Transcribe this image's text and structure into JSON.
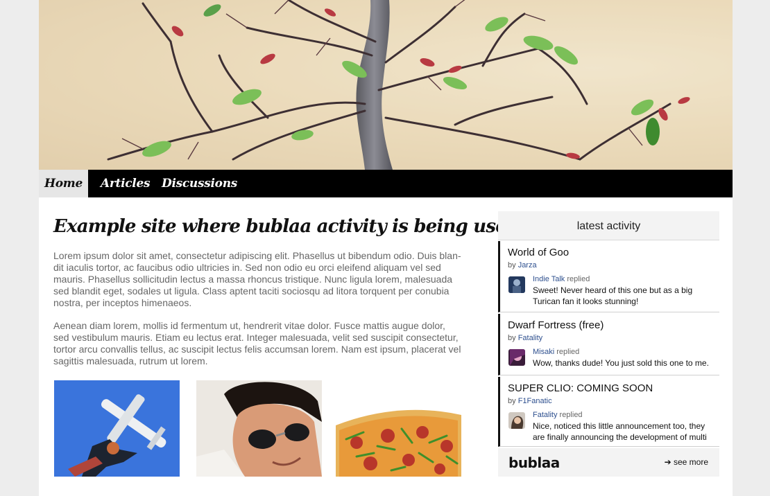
{
  "nav": {
    "items": [
      {
        "label": "Home",
        "active": true
      },
      {
        "label": "Articles",
        "active": false
      },
      {
        "label": "Discussions",
        "active": false
      }
    ]
  },
  "main": {
    "headline": "Example site where bublaa activity is being used",
    "paragraphs": [
      "Lorem ipsum dolor sit amet, consectetur adipiscing elit. Phasellus ut bibendum odio. Duis blan-dit iaculis tortor, ac faucibus odio ultricies in. Sed non odio eu orci eleifend aliquam vel sed mauris. Phasellus sollicitudin lectus a massa rhoncus tristique. Nunc ligula lorem, malesuada sed blandit eget, sodales ut ligula. Class aptent taciti sociosqu ad litora torquent per conubia nostra, per inceptos himenaeos.",
      "Aenean diam lorem, mollis id fermentum ut, hendrerit vitae dolor. Fusce mattis augue dolor, sed vestibulum mauris. Etiam eu lectus erat. Integer malesuada, velit sed suscipit consectetur, tortor arcu convallis tellus, ac suscipit lectus felis accumsan lorem. Nam est ipsum, placerat vel sagittis malesuada, rutrum ut lorem."
    ]
  },
  "sidebar": {
    "title": "latest activity",
    "by_prefix": "by",
    "replied_word": "replied",
    "activities": [
      {
        "title": "World of Goo",
        "author": "Jarza",
        "reply_user": "Indie Talk",
        "reply_text": "Sweet! Never heard of this one but as a big Turican fan it looks  stunning!"
      },
      {
        "title": "Dwarf Fortress (free)",
        "author": "Fatality",
        "reply_user": "Misaki",
        "reply_text": "Wow, thanks dude! You just sold this one to me."
      },
      {
        "title": "SUPER CLIO: COMING SOON",
        "author": "F1Fanatic",
        "reply_user": "Fatality",
        "reply_text": "Nice, noticed this little announcement too, they are finally announcing  the development of multi"
      }
    ],
    "footer": {
      "logo": "bublaa",
      "see_more_arrow": "➔",
      "see_more": "see more"
    }
  }
}
